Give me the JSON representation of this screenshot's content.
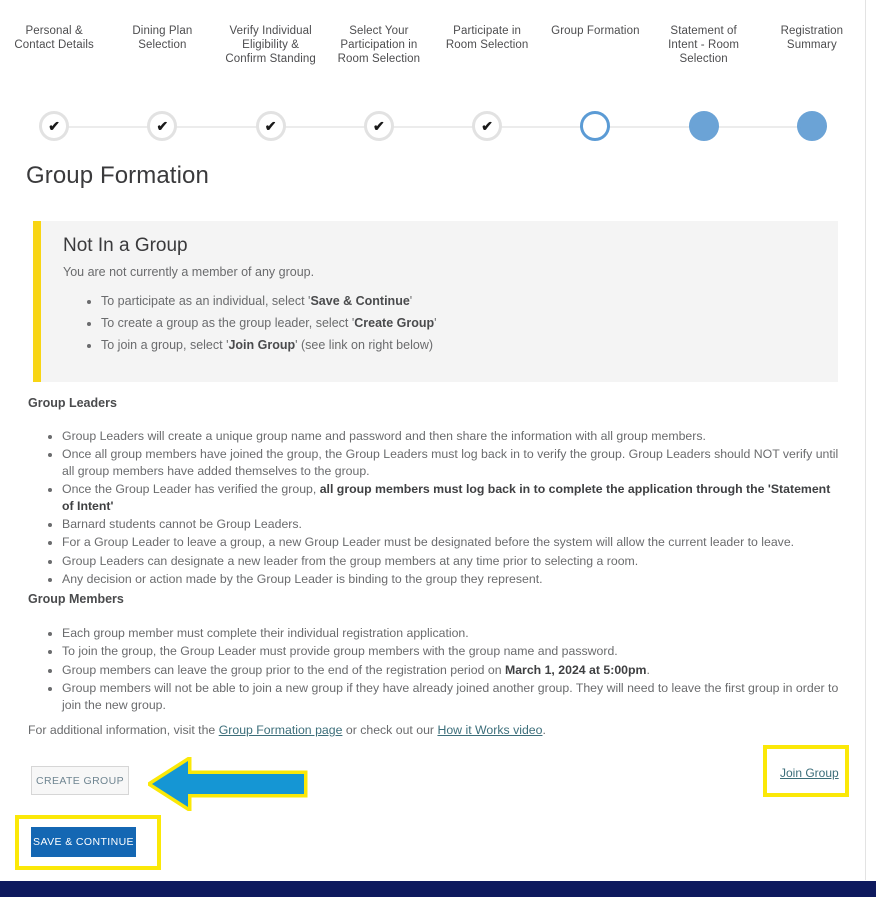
{
  "stepper": {
    "steps": [
      {
        "label": "Personal & Contact Details",
        "state": "done"
      },
      {
        "label": "Dining Plan Selection",
        "state": "done"
      },
      {
        "label": "Verify Individual Eligibility & Confirm Standing",
        "state": "done"
      },
      {
        "label": "Select Your Participation in Room Selection",
        "state": "done"
      },
      {
        "label": "Participate in Room Selection",
        "state": "done"
      },
      {
        "label": "Group Formation",
        "state": "current"
      },
      {
        "label": "Statement of Intent - Room Selection",
        "state": "future"
      },
      {
        "label": "Registration Summary",
        "state": "future"
      }
    ],
    "check_glyph": "✔"
  },
  "page": {
    "title": "Group Formation"
  },
  "alert": {
    "heading": "Not In a Group",
    "subtext": "You are not currently a member of any group.",
    "bullets": [
      {
        "pre": "To participate as an individual, select '",
        "strong": "Save & Continue",
        "post": "'"
      },
      {
        "pre": "To create a group as the group leader, select '",
        "strong": "Create Group",
        "post": "'"
      },
      {
        "pre": "To join a group, select '",
        "strong": "Join Group",
        "post": "' (see link on right below)"
      }
    ],
    "accent_color": "#f8d514",
    "background_color": "#f4f4f4"
  },
  "leaders": {
    "heading": "Group Leaders",
    "bullets": [
      {
        "pre": "Group Leaders will create a unique group name and password and then share the information with all group members.",
        "strong": "",
        "post": ""
      },
      {
        "pre": "Once all group members have joined the group, the Group Leaders must log back in to verify the group. Group Leaders should NOT verify until all group members have added themselves to the group.",
        "strong": "",
        "post": ""
      },
      {
        "pre": "Once the Group Leader has verified the group, ",
        "strong": "all group members must log back in to complete the application through the 'Statement of Intent'",
        "post": ""
      },
      {
        "pre": "Barnard students cannot be Group Leaders.",
        "strong": "",
        "post": ""
      },
      {
        "pre": "For a Group Leader to leave a group, a new Group Leader must be designated before the system will allow the current leader to leave.",
        "strong": "",
        "post": ""
      },
      {
        "pre": "Group Leaders can designate a new leader from the group members at any time prior to selecting a room.",
        "strong": "",
        "post": ""
      },
      {
        "pre": "Any decision or action made by the Group Leader is binding to the group they represent.",
        "strong": "",
        "post": ""
      }
    ]
  },
  "members": {
    "heading": "Group Members",
    "bullets": [
      {
        "pre": "Each group member must complete their individual registration application.",
        "strong": "",
        "post": ""
      },
      {
        "pre": "To join the group, the Group Leader must provide group members with the group name and password.",
        "strong": "",
        "post": ""
      },
      {
        "pre": "Group members can leave the group prior to the end of the registration period on ",
        "strong": "March 1, 2024 at 5:00pm",
        "post": "."
      },
      {
        "pre": "Group members will not be able to join a new group if they have already joined another group. They will need to leave the first group in order to join the new group.",
        "strong": "",
        "post": ""
      }
    ]
  },
  "info_line": {
    "pre": "For additional information, visit the ",
    "link1": "Group Formation page",
    "mid": " or check out our ",
    "link2": "How it Works video",
    "post": "."
  },
  "actions": {
    "create_group_label": "CREATE GROUP",
    "save_continue_label": "SAVE & CONTINUE",
    "join_group_label": "Join Group"
  },
  "annotations": {
    "highlight_color": "#fbe807",
    "arrow_fill": "#1596d4",
    "arrow_stroke": "#fbe807"
  },
  "colors": {
    "primary_button": "#1467b3",
    "step_future": "#6ba3d6",
    "step_current_ring": "#5b9bd5",
    "link": "#3c6e7a",
    "footer_bar": "#0e1a5e"
  }
}
